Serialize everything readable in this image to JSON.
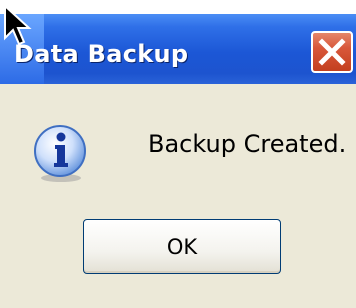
{
  "window": {
    "title": "Data Backup",
    "close_icon": "close-x-icon"
  },
  "dialog": {
    "icon": "info-icon",
    "message": "Backup Created.",
    "ok_label": "OK"
  },
  "colors": {
    "titlebar": "#1c57d6",
    "close_button": "#d8573a",
    "dialog_background": "#ece9d8"
  }
}
